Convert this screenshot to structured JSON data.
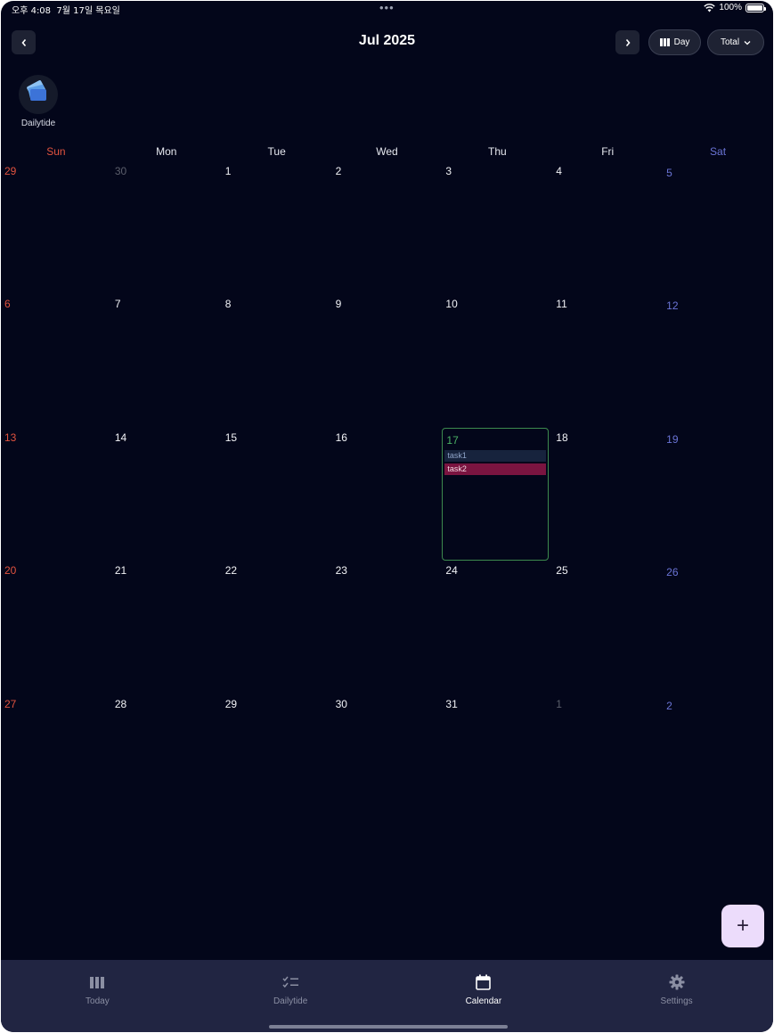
{
  "status_bar": {
    "time": "오후 4:08",
    "date": "7월 17일 목요일",
    "battery": "100%"
  },
  "header": {
    "title": "Jul 2025",
    "view_button": "Day",
    "filter_button": "Total"
  },
  "app_shortcut": {
    "label": "Dailytide"
  },
  "weekdays": [
    "Sun",
    "Mon",
    "Tue",
    "Wed",
    "Thu",
    "Fri",
    "Sat"
  ],
  "weeks": [
    [
      {
        "day": "29",
        "type": "other-sun"
      },
      {
        "day": "30",
        "type": "other"
      },
      {
        "day": "1"
      },
      {
        "day": "2"
      },
      {
        "day": "3"
      },
      {
        "day": "4"
      },
      {
        "day": "5",
        "type": "sat"
      }
    ],
    [
      {
        "day": "6",
        "type": "sun"
      },
      {
        "day": "7"
      },
      {
        "day": "8"
      },
      {
        "day": "9"
      },
      {
        "day": "10"
      },
      {
        "day": "11"
      },
      {
        "day": "12",
        "type": "sat"
      }
    ],
    [
      {
        "day": "13",
        "type": "sun"
      },
      {
        "day": "14"
      },
      {
        "day": "15"
      },
      {
        "day": "16"
      },
      {
        "day": "17",
        "type": "today",
        "tasks": [
          "task1",
          "task2"
        ]
      },
      {
        "day": "18"
      },
      {
        "day": "19",
        "type": "sat"
      }
    ],
    [
      {
        "day": "20",
        "type": "sun"
      },
      {
        "day": "21"
      },
      {
        "day": "22"
      },
      {
        "day": "23"
      },
      {
        "day": "24"
      },
      {
        "day": "25"
      },
      {
        "day": "26",
        "type": "sat"
      }
    ],
    [
      {
        "day": "27",
        "type": "sun"
      },
      {
        "day": "28"
      },
      {
        "day": "29"
      },
      {
        "day": "30"
      },
      {
        "day": "31"
      },
      {
        "day": "1",
        "type": "other"
      },
      {
        "day": "2",
        "type": "sat"
      }
    ]
  ],
  "tabs": [
    {
      "label": "Today",
      "icon": "columns-icon"
    },
    {
      "label": "Dailytide",
      "icon": "checklist-icon"
    },
    {
      "label": "Calendar",
      "icon": "calendar-icon",
      "active": true
    },
    {
      "label": "Settings",
      "icon": "gear-icon"
    }
  ],
  "fab": {
    "label": "+"
  },
  "colors": {
    "background": "#03061a",
    "sunday": "#e2533f",
    "saturday": "#6a74d6",
    "today": "#4bb265",
    "task1": "#17233d",
    "task2": "#7a1440",
    "tabbar": "#212542",
    "fab": "#ecdcfb"
  }
}
